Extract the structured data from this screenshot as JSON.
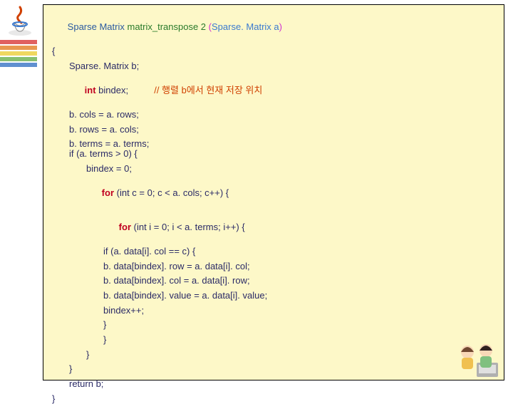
{
  "code": {
    "sig_type": "Sparse Matrix ",
    "sig_fn": "matrix_transpose 2 ",
    "sig_open": "(",
    "sig_param": "Sparse. Matrix a",
    "sig_close": ")",
    "open_brace": "{",
    "decl_b": "Sparse. Matrix b;",
    "decl_bi_kw": "int ",
    "decl_bi_name": "bindex;          ",
    "decl_bi_cmt": "// 행렬 b에서 현재 저장 위치",
    "assign_cols": "b. cols = a. rows;",
    "assign_rows": "b. rows = a. cols;",
    "assign_terms": "b. terms = a. terms;",
    "if_cond": "if (a. terms > 0) {",
    "bindex0": "bindex = 0;",
    "for1_kw": "for ",
    "for1_rest": "(int c = 0; c < a. cols; c++) {",
    "for2_kw": "for ",
    "for2_rest": "(int i = 0; i < a. terms; i++) {",
    "if_inner": "if (a. data[i]. col == c) {",
    "assign1": "b. data[bindex]. row = a. data[i]. col;",
    "assign2": "b. data[bindex]. col = a. data[i]. row;",
    "assign3": "b. data[bindex]. value = a. data[i]. value;",
    "binc": "bindex++;",
    "brace_close": "}",
    "return_b": "return b;"
  }
}
